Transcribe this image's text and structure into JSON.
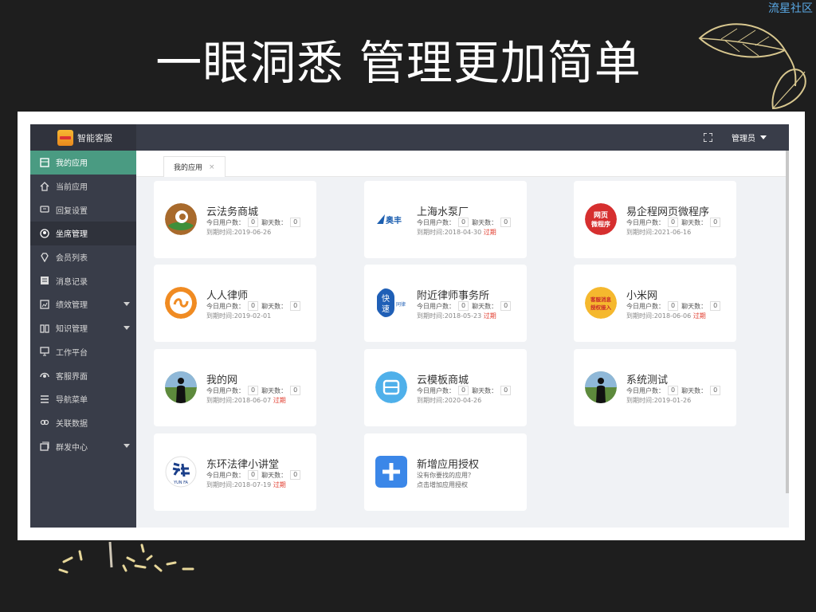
{
  "watermark": "流星社区",
  "slide_title": "一眼洞悉 管理更加简单",
  "app": {
    "brand": "智能客服",
    "sidebar": [
      {
        "label": "我的应用",
        "icon": "app-icon",
        "state": "active"
      },
      {
        "label": "当前应用",
        "icon": "home-icon"
      },
      {
        "label": "回复设置",
        "icon": "reply-icon"
      },
      {
        "label": "坐席管理",
        "icon": "user-icon",
        "state": "selected"
      },
      {
        "label": "会员列表",
        "icon": "diamond-icon"
      },
      {
        "label": "消息记录",
        "icon": "message-icon"
      },
      {
        "label": "绩效管理",
        "icon": "chart-icon",
        "caret": true
      },
      {
        "label": "知识管理",
        "icon": "book-icon",
        "caret": true
      },
      {
        "label": "工作平台",
        "icon": "monitor-icon"
      },
      {
        "label": "客服界面",
        "icon": "headset-icon"
      },
      {
        "label": "导航菜单",
        "icon": "menu-icon"
      },
      {
        "label": "关联数据",
        "icon": "link-icon"
      },
      {
        "label": "群发中心",
        "icon": "broadcast-icon",
        "caret": true
      }
    ],
    "admin_label": "管理员",
    "tab_label": "我的应用",
    "tab_close": "×",
    "stat_labels": {
      "today_users": "今日用户数：",
      "chat_days": "聊天数："
    },
    "expire_prefix": "到期时间:",
    "expired_label": "过期",
    "cards": [
      {
        "name": "云法务商城",
        "today": "0",
        "chats": "0",
        "expire": "2019-06-26",
        "expired": false,
        "logo": "fawu-logo"
      },
      {
        "name": "上海水泵厂",
        "today": "0",
        "chats": "0",
        "expire": "2018-04-30",
        "expired": true,
        "logo": "aofeng-logo"
      },
      {
        "name": "易企程网页微程序",
        "today": "0",
        "chats": "0",
        "expire": "2021-06-16",
        "expired": false,
        "logo": "webpage-logo"
      },
      {
        "name": "人人律师",
        "today": "0",
        "chats": "0",
        "expire": "2019-02-01",
        "expired": false,
        "logo": "lawyer-logo"
      },
      {
        "name": "附近律师事务所",
        "today": "0",
        "chats": "0",
        "expire": "2018-05-23",
        "expired": true,
        "logo": "kuaisu-logo"
      },
      {
        "name": "小米网",
        "today": "0",
        "chats": "0",
        "expire": "2018-06-06",
        "expired": true,
        "logo": "kefu-logo"
      },
      {
        "name": "我的网",
        "today": "0",
        "chats": "0",
        "expire": "2018-06-07",
        "expired": true,
        "logo": "silhouette-logo"
      },
      {
        "name": "云模板商城",
        "today": "0",
        "chats": "0",
        "expire": "2020-04-26",
        "expired": false,
        "logo": "template-logo"
      },
      {
        "name": "系统测试",
        "today": "0",
        "chats": "0",
        "expire": "2019-01-26",
        "expired": false,
        "logo": "silhouette-logo"
      },
      {
        "name": "东环法律小讲堂",
        "today": "0",
        "chats": "0",
        "expire": "2018-07-19",
        "expired": true,
        "logo": "yunfa-logo"
      }
    ],
    "add_card": {
      "title": "新增应用授权",
      "line1": "没有你要找的应用？",
      "line2": "点击增加应用授权"
    },
    "logo_text": {
      "webpage": [
        "网页",
        "微程序"
      ],
      "kuaisu": [
        "快",
        "速"
      ],
      "kuaisu_side": "同律",
      "kefu": [
        "客服消息",
        "授权接入"
      ],
      "aofeng": "奥丰",
      "yunfa": "YUN FA"
    }
  }
}
